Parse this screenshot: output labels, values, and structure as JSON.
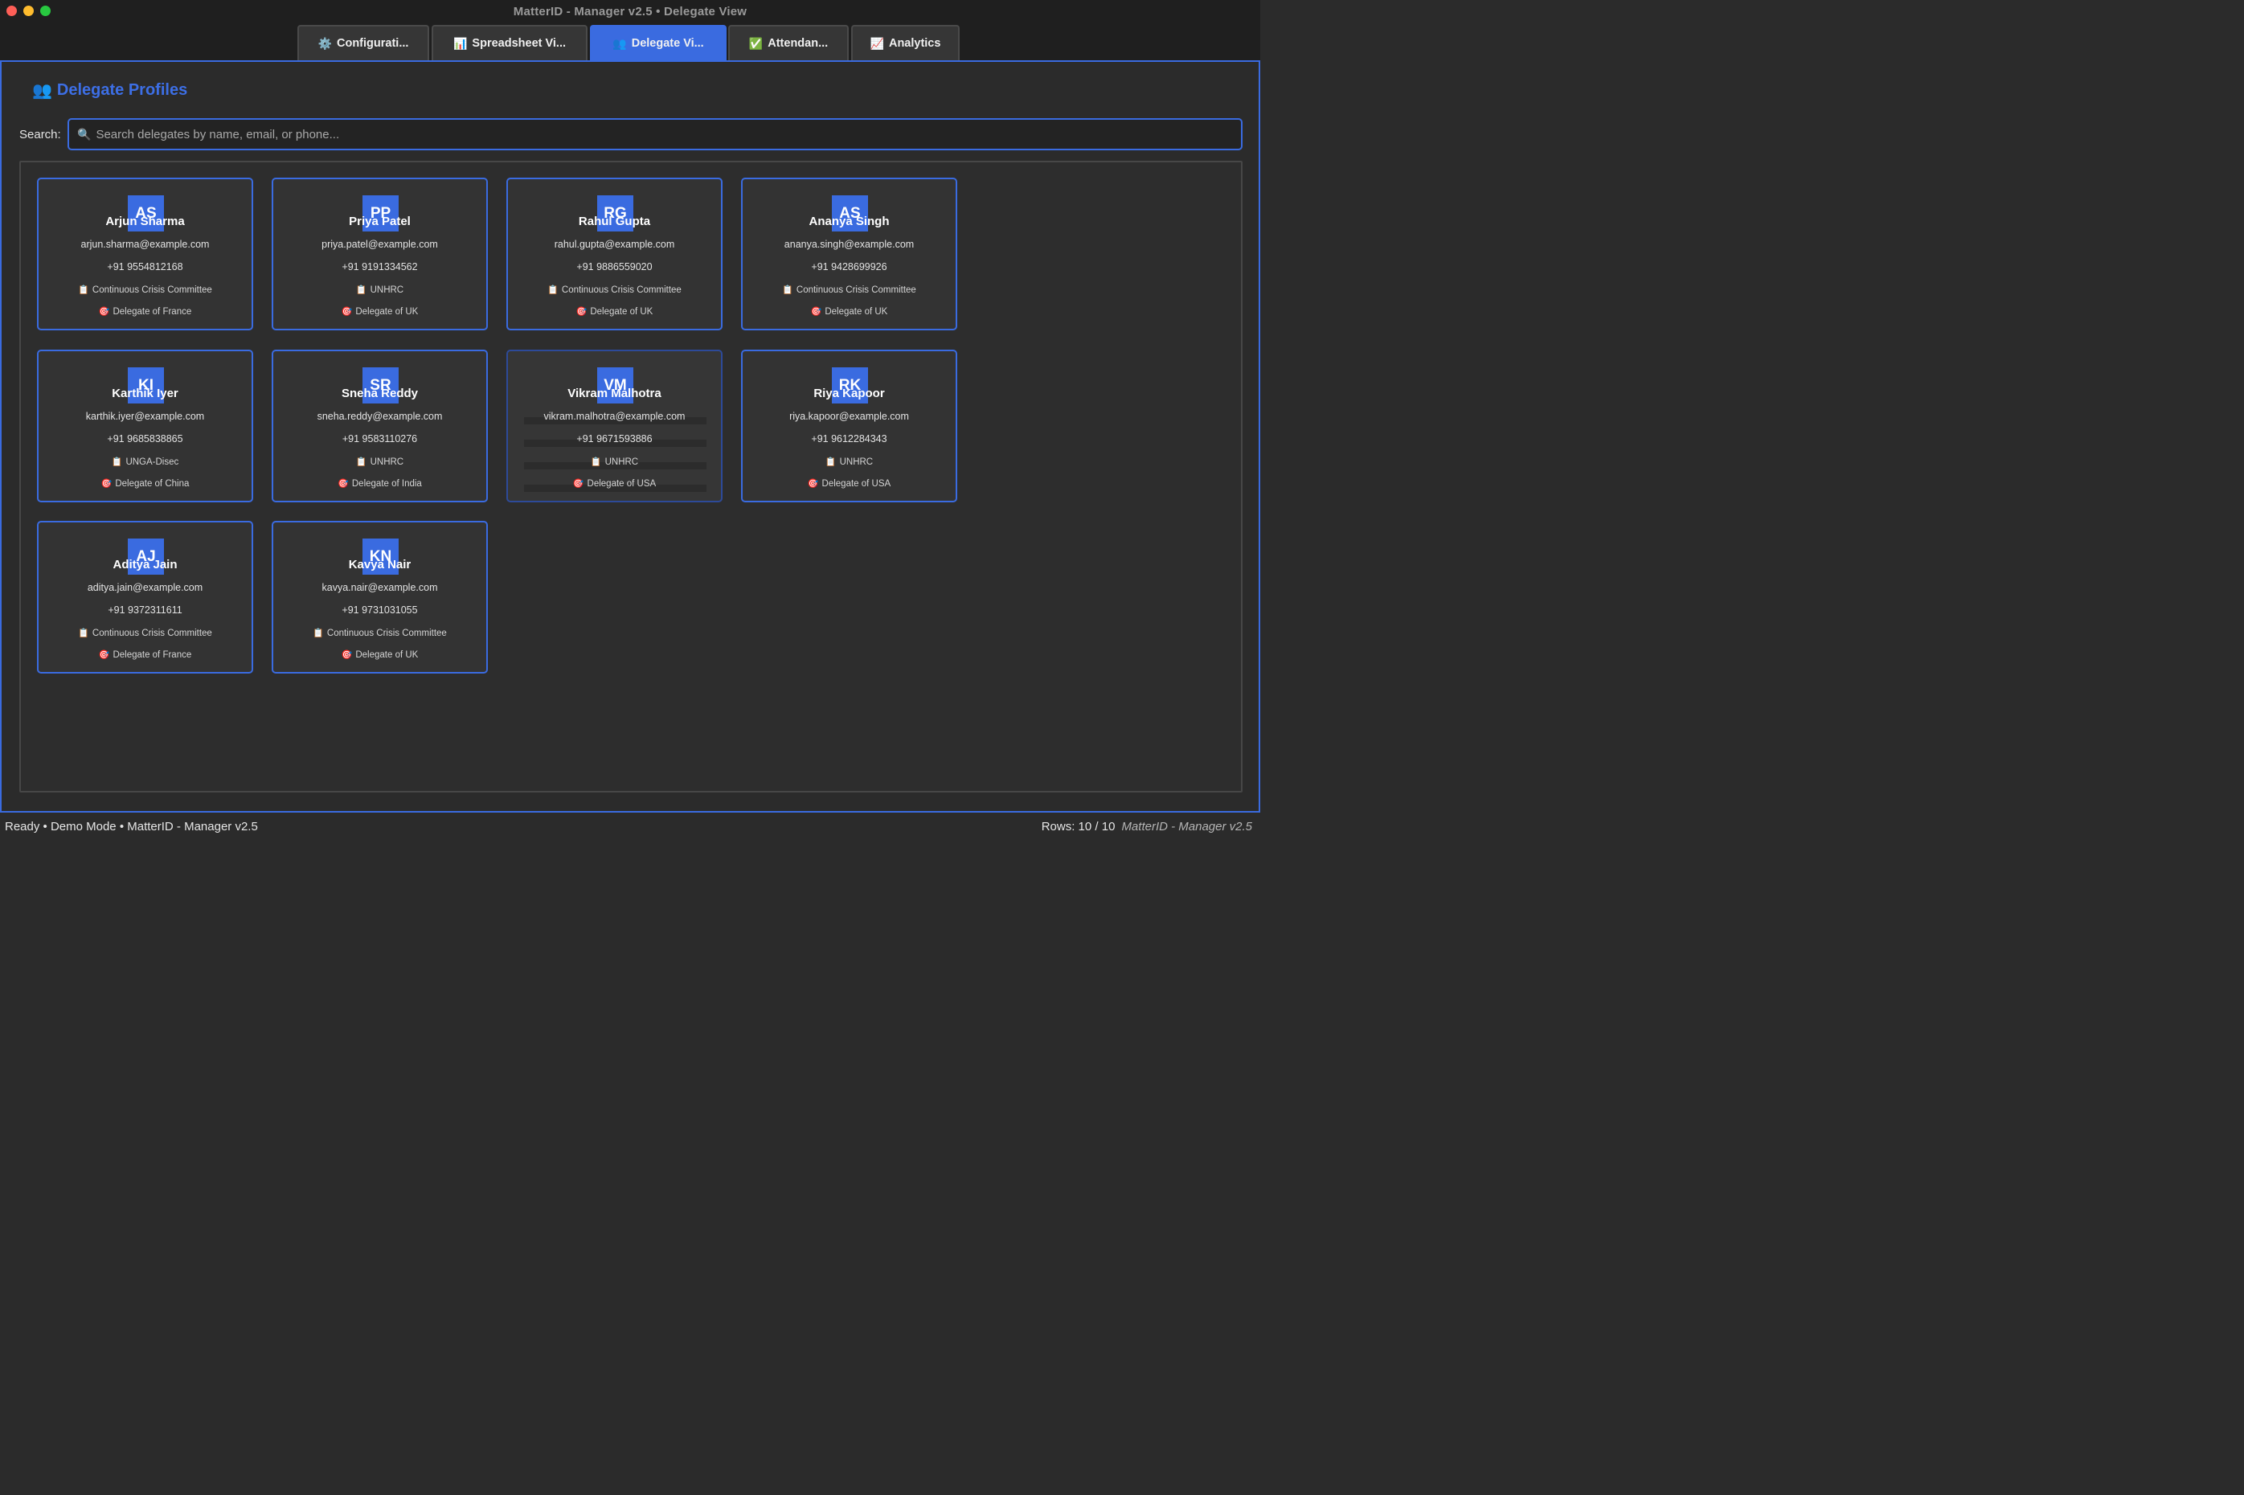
{
  "window": {
    "title": "MatterID - Manager v2.5 • Delegate View"
  },
  "tabs": [
    {
      "icon": "⚙️",
      "label": "Configurati...",
      "active": false
    },
    {
      "icon": "📊",
      "label": "Spreadsheet Vi...",
      "active": false
    },
    {
      "icon": "👥",
      "label": "Delegate Vi...",
      "active": true
    },
    {
      "icon": "✅",
      "label": "Attendan...",
      "active": false
    },
    {
      "icon": "📈",
      "label": "Analytics",
      "active": false
    }
  ],
  "page": {
    "title_icon": "👥",
    "title": "Delegate Profiles"
  },
  "search": {
    "label": "Search:",
    "icon": "🔍",
    "value": "",
    "placeholder": "Search delegates by name, email, or phone..."
  },
  "delegates": [
    {
      "initials": "AS",
      "name": "Arjun Sharma",
      "email": "arjun.sharma@example.com",
      "phone": "+91 9554812168",
      "committee": "Continuous Crisis Committee",
      "role": "Delegate of France"
    },
    {
      "initials": "PP",
      "name": "Priya Patel",
      "email": "priya.patel@example.com",
      "phone": "+91 9191334562",
      "committee": "UNHRC",
      "role": "Delegate of UK"
    },
    {
      "initials": "RG",
      "name": "Rahul Gupta",
      "email": "rahul.gupta@example.com",
      "phone": "+91 9886559020",
      "committee": "Continuous Crisis Committee",
      "role": "Delegate of UK"
    },
    {
      "initials": "AS",
      "name": "Ananya Singh",
      "email": "ananya.singh@example.com",
      "phone": "+91 9428699926",
      "committee": "Continuous Crisis Committee",
      "role": "Delegate of UK"
    },
    {
      "initials": "KI",
      "name": "Karthik Iyer",
      "email": "karthik.iyer@example.com",
      "phone": "+91 9685838865",
      "committee": "UNGA-Disec",
      "role": "Delegate of China"
    },
    {
      "initials": "SR",
      "name": "Sneha Reddy",
      "email": "sneha.reddy@example.com",
      "phone": "+91 9583110276",
      "committee": "UNHRC",
      "role": "Delegate of India"
    },
    {
      "initials": "VM",
      "name": "Vikram Malhotra",
      "email": "vikram.malhotra@example.com",
      "phone": "+91 9671593886",
      "committee": "UNHRC",
      "role": "Delegate of USA"
    },
    {
      "initials": "RK",
      "name": "Riya Kapoor",
      "email": "riya.kapoor@example.com",
      "phone": "+91 9612284343",
      "committee": "UNHRC",
      "role": "Delegate of USA"
    },
    {
      "initials": "AJ",
      "name": "Aditya Jain",
      "email": "aditya.jain@example.com",
      "phone": "+91 9372311611",
      "committee": "Continuous Crisis Committee",
      "role": "Delegate of France"
    },
    {
      "initials": "KN",
      "name": "Kavya Nair",
      "email": "kavya.nair@example.com",
      "phone": "+91 9731031055",
      "committee": "Continuous Crisis Committee",
      "role": "Delegate of UK"
    }
  ],
  "card_icons": {
    "committee": "📋",
    "role": "🎯"
  },
  "statusbar": {
    "left": "Ready • Demo Mode • MatterID - Manager v2.5",
    "rows": "Rows: 10 / 10",
    "app": "MatterID - Manager v2.5"
  },
  "colors": {
    "accent": "#3a6be0",
    "background": "#2b2b2b",
    "titlebar": "#1f1f1f"
  }
}
